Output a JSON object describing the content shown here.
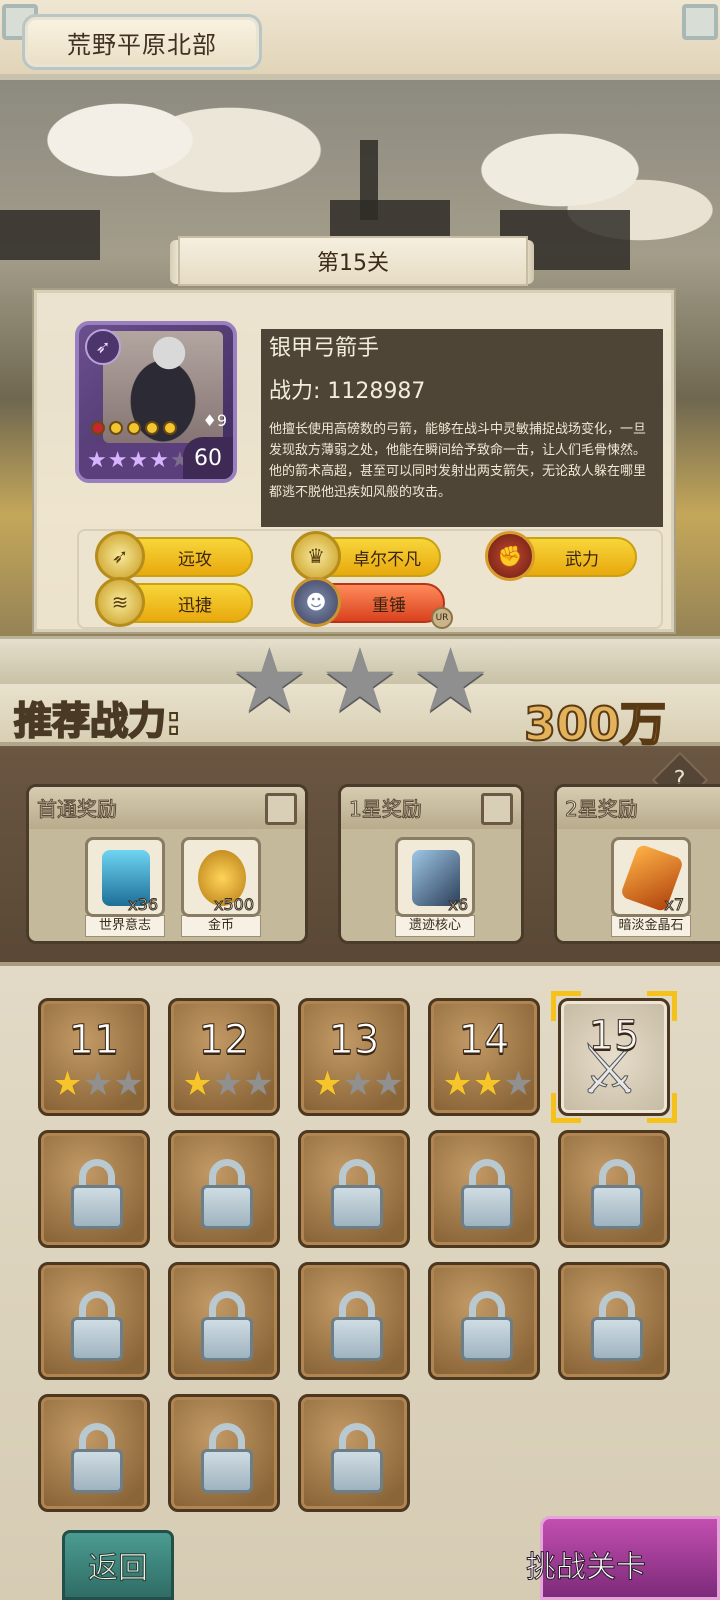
{
  "region": {
    "name": "荒野平原北部"
  },
  "stage": {
    "title": "第15关"
  },
  "enemy": {
    "name": "银甲弓箭手",
    "power_text": "战力: 1128987",
    "description": "他擅长使用高磅数的弓箭，能够在战斗中灵敏捕捉战场变化，一旦发现敌方薄弱之处，他能在瞬间给予致命一击，让人们毛骨悚然。他的箭术高超，甚至可以同时发射出两支箭矢，无论敌人躲在哪里都逃不脱他迅疾如风般的攻击。",
    "portrait": {
      "class_icon": "bow-icon",
      "small_level": "9",
      "level": "60",
      "star_glyph": "★",
      "stars_filled": 4,
      "stars_total": 5
    },
    "traits": [
      {
        "label": "远攻",
        "icon": "bow-icon",
        "glyph": "➶"
      },
      {
        "label": "卓尔不凡",
        "icon": "crown-icon",
        "glyph": "♛"
      },
      {
        "label": "武力",
        "icon": "fist-icon",
        "glyph": "✊"
      },
      {
        "label": "迅捷",
        "icon": "wing-icon",
        "glyph": "≋"
      },
      {
        "label": "重锤",
        "icon": "hero-portrait-icon",
        "glyph": "☻",
        "tag": "UR"
      }
    ]
  },
  "recommended": {
    "label": "推荐战力:",
    "value": "300万",
    "star_glyph": "★"
  },
  "rewards": [
    {
      "title": "首通奖励",
      "items": [
        {
          "name": "世界意志",
          "count": "x36",
          "icon": "blue-crystal-jar-icon",
          "color": "#2e8fb8"
        },
        {
          "name": "金币",
          "count": "x500",
          "icon": "gold-coin-icon",
          "color": "#e0a526"
        }
      ]
    },
    {
      "title": "1星奖励",
      "items": [
        {
          "name": "遗迹核心",
          "count": "x6",
          "icon": "dark-crystal-icon",
          "color": "#3f5b7a"
        }
      ]
    },
    {
      "title": "2星奖励",
      "items": [
        {
          "name": "暗淡金晶石",
          "count": "x7",
          "icon": "orange-gem-icon",
          "color": "#d96a1c"
        }
      ]
    }
  ],
  "help": {
    "glyph": "?"
  },
  "stages": [
    {
      "number": "11",
      "stars": 1,
      "state": "cleared"
    },
    {
      "number": "12",
      "stars": 1,
      "state": "cleared"
    },
    {
      "number": "13",
      "stars": 1,
      "state": "cleared"
    },
    {
      "number": "14",
      "stars": 2,
      "state": "cleared"
    },
    {
      "number": "15",
      "stars": 0,
      "state": "current"
    },
    {
      "state": "locked"
    },
    {
      "state": "locked"
    },
    {
      "state": "locked"
    },
    {
      "state": "locked"
    },
    {
      "state": "locked"
    },
    {
      "state": "locked"
    },
    {
      "state": "locked"
    },
    {
      "state": "locked"
    },
    {
      "state": "locked"
    },
    {
      "state": "locked"
    },
    {
      "state": "locked"
    },
    {
      "state": "locked"
    },
    {
      "state": "locked"
    }
  ],
  "stage_star_glyph": "★",
  "current_stage_glyph": "⚔",
  "buttons": {
    "back": "返回",
    "challenge": "挑战关卡"
  }
}
